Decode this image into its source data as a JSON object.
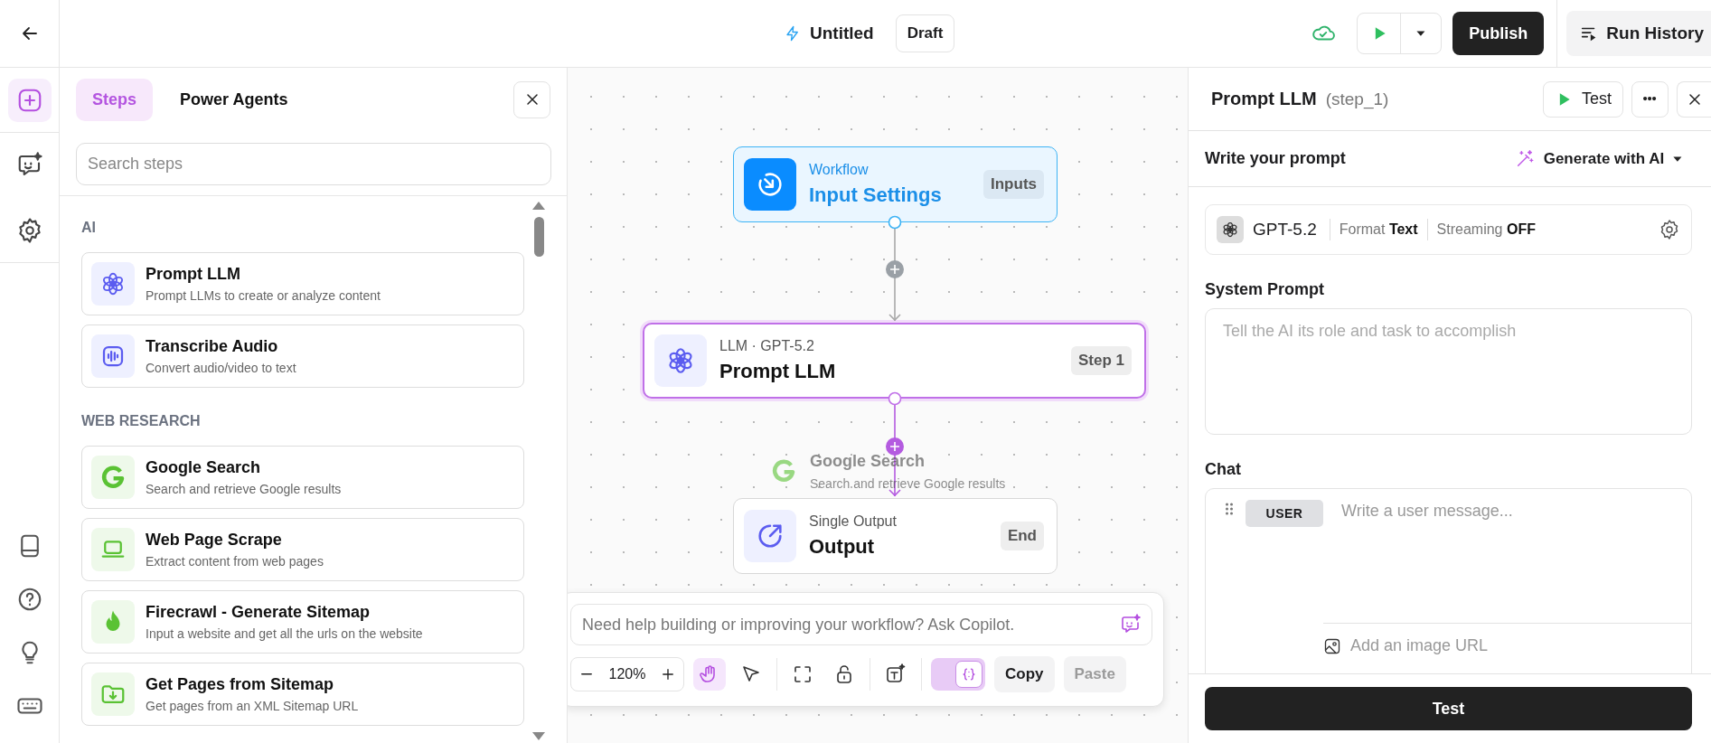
{
  "top_bar": {
    "title": "Untitled",
    "status": "Draft",
    "publish": "Publish",
    "run_history": "Run History"
  },
  "rail": {
    "top": [
      {
        "kind": "add",
        "selected": true
      },
      {
        "kind": "copilot",
        "selected": false
      },
      {
        "kind": "settings",
        "selected": false
      }
    ],
    "bottom": [
      {
        "kind": "book"
      },
      {
        "kind": "help"
      },
      {
        "kind": "bulb"
      },
      {
        "kind": "keyboard"
      }
    ]
  },
  "steps_panel": {
    "tabs": [
      {
        "label": "Steps",
        "selected": true
      },
      {
        "label": "Power Agents",
        "selected": false
      }
    ],
    "search": {
      "placeholder": "Search steps"
    },
    "sections": [
      {
        "heading": "AI",
        "items": [
          {
            "kind": "flower",
            "title": "Prompt LLM",
            "description": "Prompt LLMs to create or analyze content"
          },
          {
            "kind": "audio",
            "title": "Transcribe Audio",
            "description": "Convert audio/video to text"
          }
        ]
      },
      {
        "heading": "WEB RESEARCH",
        "items": [
          {
            "kind": "g",
            "title": "Google Search",
            "description": "Search and retrieve Google results"
          },
          {
            "kind": "laptop",
            "title": "Web Page Scrape",
            "description": "Extract content from web pages"
          },
          {
            "kind": "flame",
            "title": "Firecrawl - Generate Sitemap",
            "description": "Input a website and get all the urls on the website"
          },
          {
            "kind": "folder",
            "title": "Get Pages from Sitemap",
            "description": "Get pages from an XML Sitemap URL"
          }
        ]
      }
    ]
  },
  "canvas": {
    "nodes": [
      {
        "kind": "input",
        "subtitle": "Workflow",
        "title": "Input Settings",
        "badge": "Inputs",
        "selected": false
      },
      {
        "kind": "llm",
        "subtitle": "LLM · GPT-5.2",
        "title": "Prompt LLM",
        "badge": "Step 1",
        "selected": true
      },
      {
        "kind": "output",
        "subtitle": "Single Output",
        "title": "Output",
        "badge": "End",
        "selected": false
      }
    ],
    "drag_preview": {
      "title": "Google Search",
      "description": "Search and retrieve Google results"
    },
    "copilot": {
      "placeholder": "Need help building or improving your workflow? Ask Copilot.",
      "zoom": "120%",
      "tools": [
        {
          "kind": "hand",
          "selected": true
        },
        {
          "kind": "pointer",
          "selected": false
        }
      ],
      "json_toggle": {
        "on": true
      },
      "copy": "Copy",
      "paste": {
        "label": "Paste",
        "disabled": true
      }
    }
  },
  "step_panel": {
    "title": "Prompt LLM",
    "step_id": "(step_1)",
    "test": "Test",
    "section": "Write your prompt",
    "generate": "Generate with AI",
    "model": {
      "name": "GPT-5.2",
      "format_label": "Format",
      "format": "Text",
      "streaming_label": "Streaming",
      "streaming": "OFF"
    },
    "system_prompt": {
      "label": "System Prompt",
      "placeholder": "Tell the AI its role and task to accomplish"
    },
    "chat": {
      "label": "Chat",
      "role": "USER",
      "placeholder": "Write a user message...",
      "image_placeholder": "Add an image URL"
    },
    "footer_button": "Test"
  }
}
